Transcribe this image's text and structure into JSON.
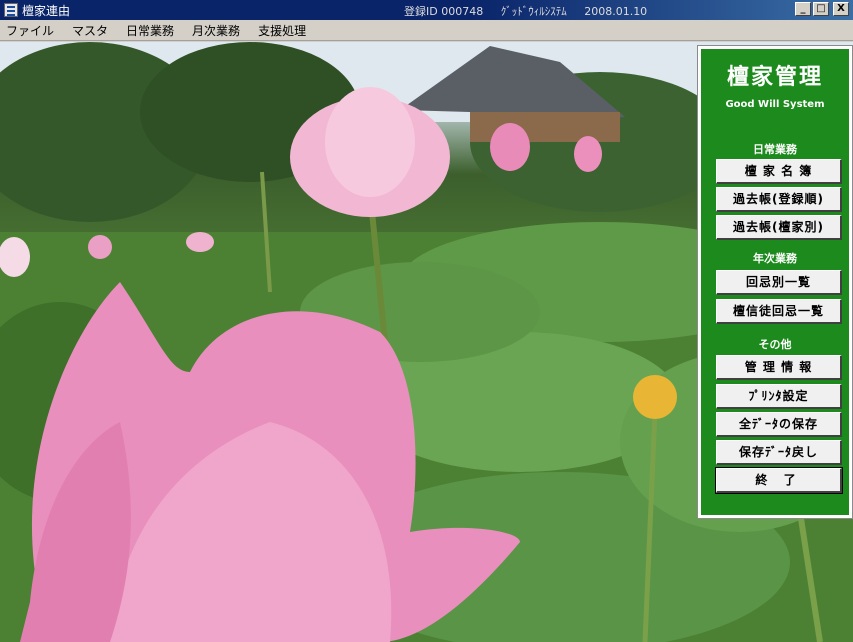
{
  "window": {
    "title": "檀家連由",
    "registration": "登録ID 000748",
    "vendor": "ｸﾞｯﾄﾞｳｨﾙｼｽﾃﾑ",
    "date": "2008.01.10",
    "controls": {
      "minimize": "_",
      "maximize": "□",
      "close": "X"
    }
  },
  "menu": {
    "items": [
      {
        "label": "ファイル"
      },
      {
        "label": "マスタ"
      },
      {
        "label": "日常業務"
      },
      {
        "label": "月次業務"
      },
      {
        "label": "支援処理"
      }
    ]
  },
  "panel": {
    "title": "檀家管理",
    "subtitle": "Good Will System",
    "sections": {
      "daily": "日常業務",
      "yearly": "年次業務",
      "other": "その他"
    },
    "buttons": {
      "danka_list": "檀 家 名 簿",
      "kakocho_reg": "過去帳(登録順)",
      "kakocho_danka": "過去帳(檀家別)",
      "kaiki_list": "回忌別一覧",
      "danshinto_kaiki": "檀信徒回忌一覧",
      "admin_info": "管 理 情 報",
      "printer": "ﾌﾟﾘﾝﾀ設定",
      "backup": "全ﾃﾞｰﾀの保存",
      "restore": "保存ﾃﾞｰﾀ戻し",
      "exit": "終 了"
    }
  },
  "icons": [
    "app-icon",
    "minimize-icon",
    "maximize-icon",
    "close-icon"
  ],
  "colors": {
    "titlebar": "#0a246a",
    "panel": "#1c8a1c",
    "button": "#f0f0f0"
  }
}
